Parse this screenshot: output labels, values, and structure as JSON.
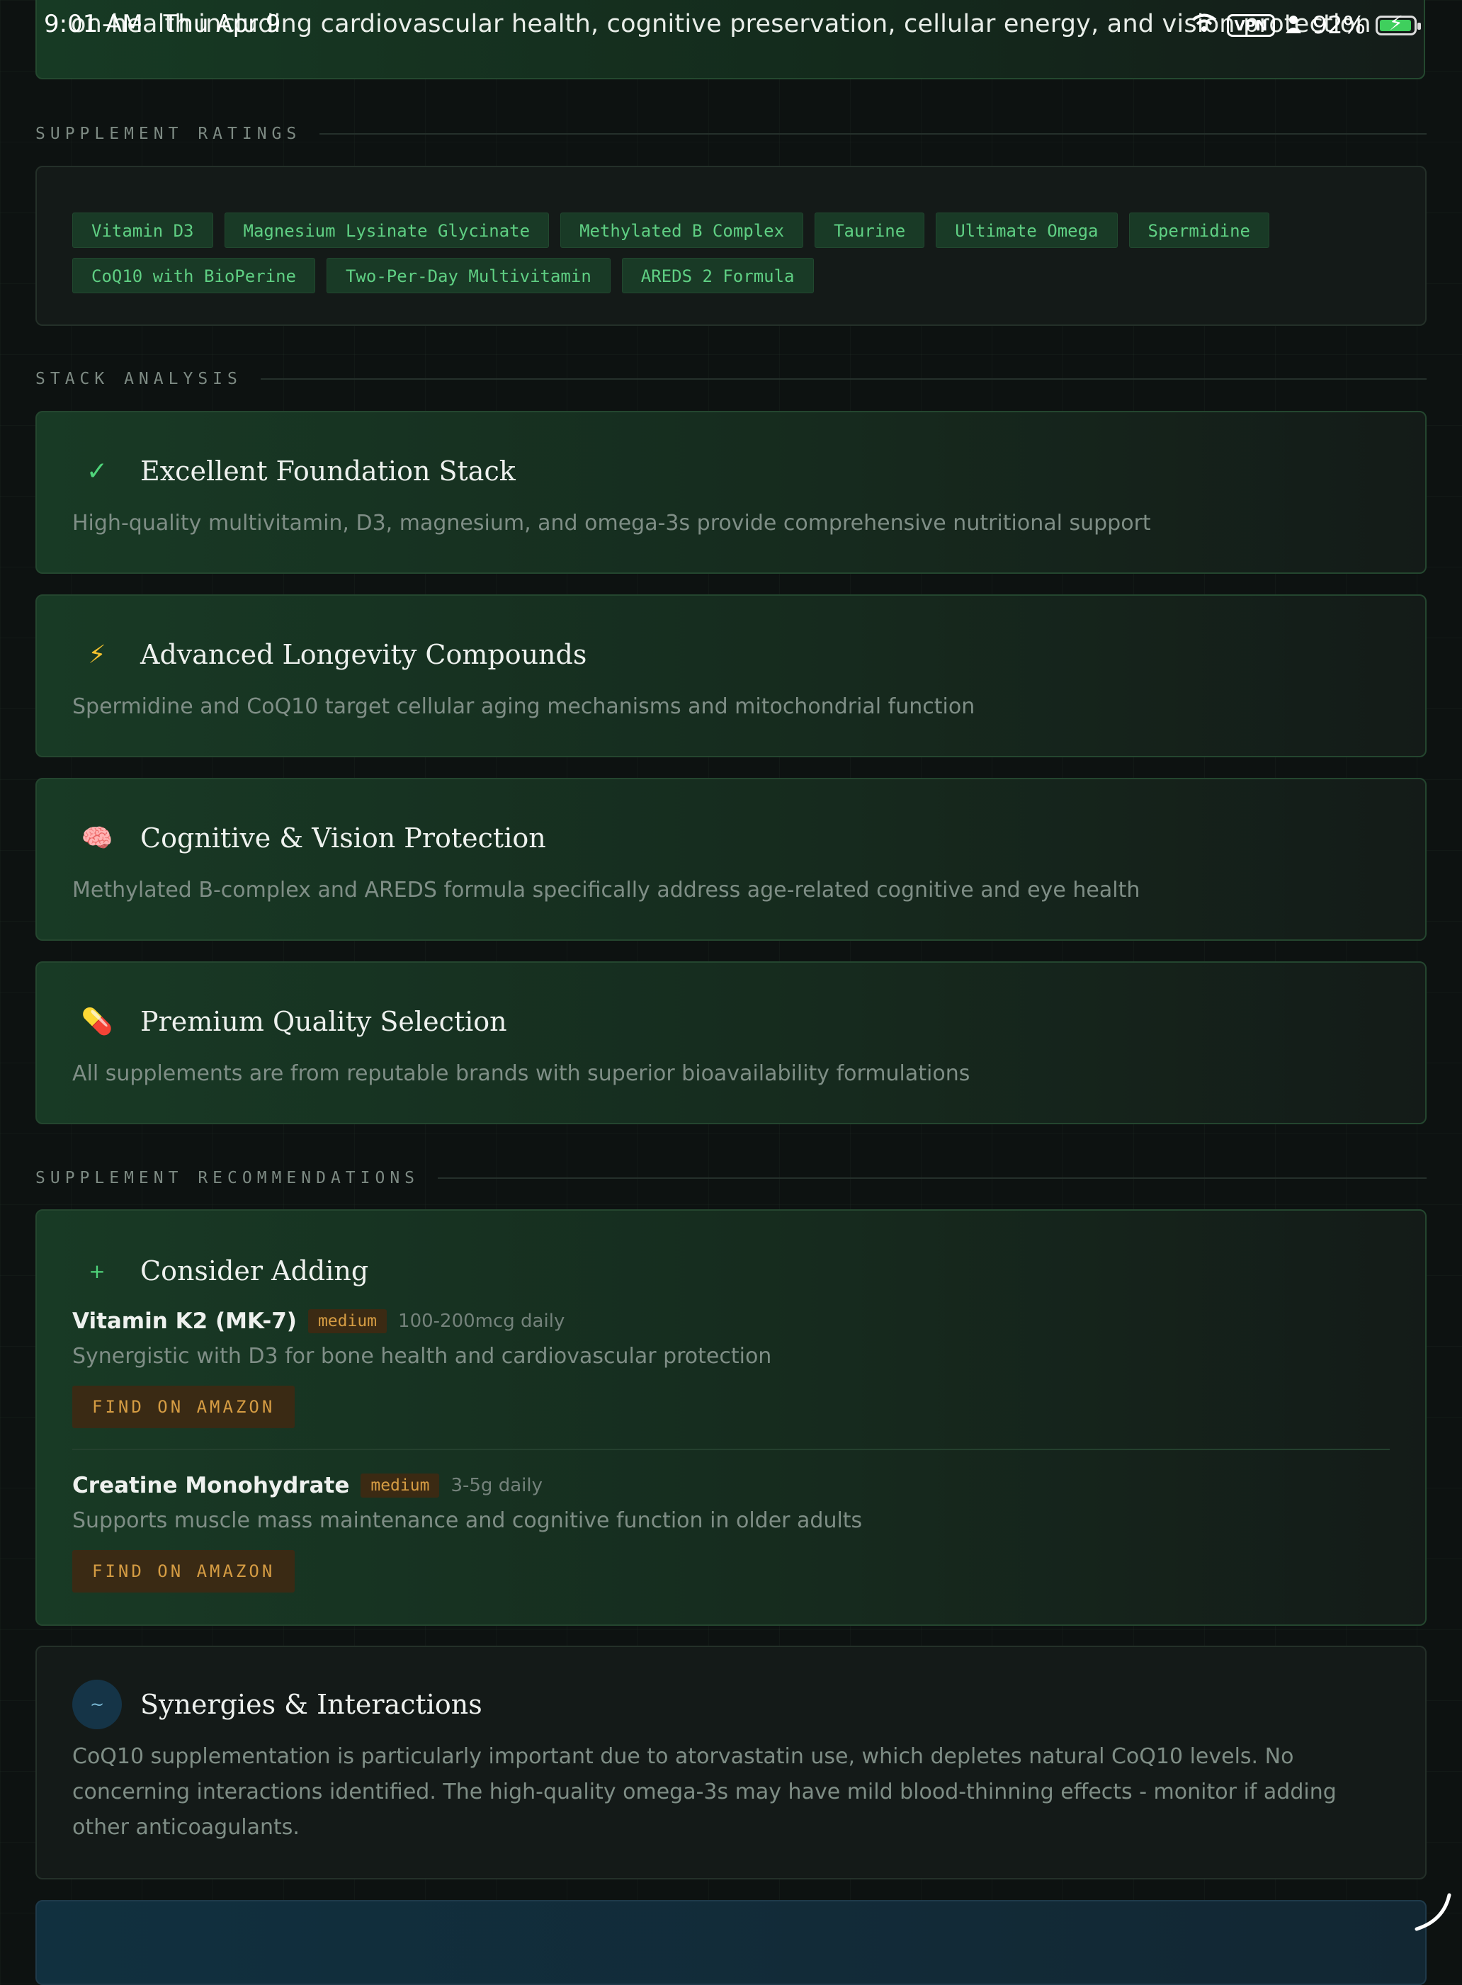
{
  "status_bar": {
    "time": "9:01 AM",
    "date": "Thu Apr 9",
    "vpn": "VPN",
    "battery": "92%"
  },
  "top_banner": {
    "text": "on-health including cardiovascular health, cognitive preservation, cellular energy, and vision protection"
  },
  "ratings": {
    "section_title": "SUPPLEMENT RATINGS",
    "items": [
      "Vitamin D3",
      "Magnesium Lysinate Glycinate",
      "Methylated B Complex",
      "Taurine",
      "Ultimate Omega",
      "Spermidine",
      "CoQ10 with BioPerine",
      "Two-Per-Day Multivitamin",
      "AREDS 2 Formula"
    ]
  },
  "analysis": {
    "section_title": "STACK ANALYSIS",
    "cards": [
      {
        "icon": "check-icon",
        "glyph": "✓",
        "title": "Excellent Foundation Stack",
        "desc": "High-quality multivitamin, D3, magnesium, and omega-3s provide comprehensive nutritional support"
      },
      {
        "icon": "lightning-icon",
        "glyph": "⚡",
        "title": "Advanced Longevity Compounds",
        "desc": "Spermidine and CoQ10 target cellular aging mechanisms and mitochondrial function"
      },
      {
        "icon": "brain-icon",
        "glyph": "🧠",
        "title": "Cognitive & Vision Protection",
        "desc": "Methylated B-complex and AREDS formula specifically address age-related cognitive and eye health"
      },
      {
        "icon": "pill-icon",
        "glyph": "💊",
        "title": "Premium Quality Selection",
        "desc": "All supplements are from reputable brands with superior bioavailability formulations"
      }
    ]
  },
  "recommendations": {
    "section_title": "SUPPLEMENT RECOMMENDATIONS",
    "card_title": "Consider Adding",
    "plus_glyph": "+",
    "items": [
      {
        "name": "Vitamin K2 (MK-7)",
        "priority": "medium",
        "dose": "100-200mcg daily",
        "desc": "Synergistic with D3 for bone health and cardiovascular protection",
        "button": "FIND ON AMAZON"
      },
      {
        "name": "Creatine Monohydrate",
        "priority": "medium",
        "dose": "3-5g daily",
        "desc": "Supports muscle mass maintenance and cognitive function in older adults",
        "button": "FIND ON AMAZON"
      }
    ]
  },
  "synergies": {
    "title": "Synergies & Interactions",
    "glyph": "~",
    "desc": "CoQ10 supplementation is particularly important due to atorvastatin use, which depletes natural CoQ10 levels. No concerning interactions identified. The high-quality omega-3s may have mild blood-thinning effects - monitor if adding other anticoagulants."
  },
  "colors": {
    "accent_green": "#5fcf83",
    "priority_orange": "#d59c43",
    "background": "#0d1211"
  }
}
